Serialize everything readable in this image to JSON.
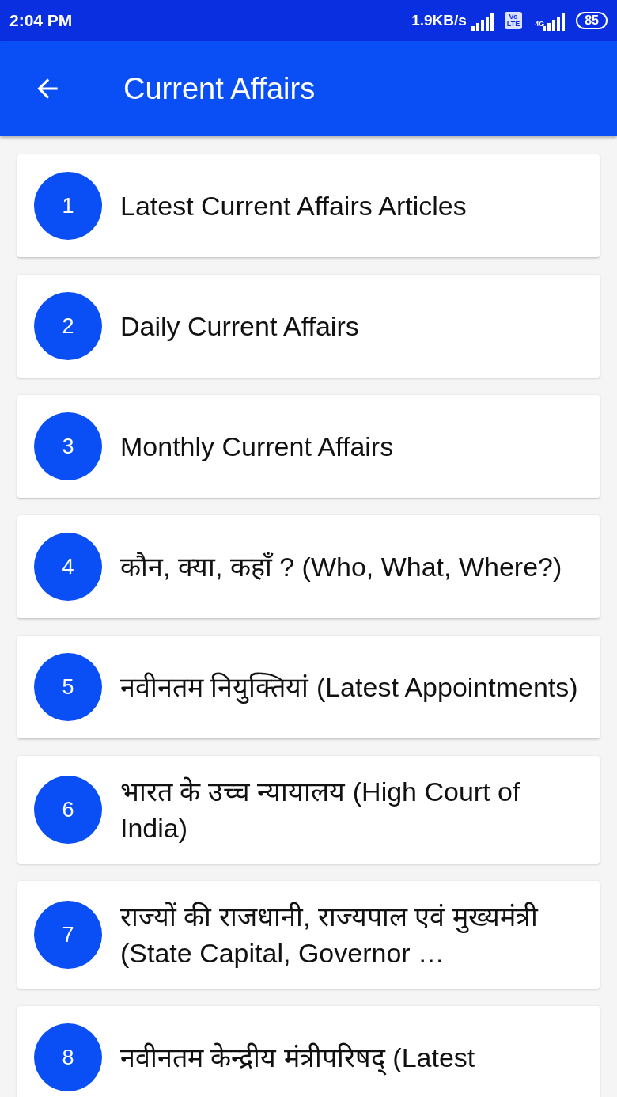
{
  "status_bar": {
    "time": "2:04 PM",
    "network_speed": "1.9KB/s",
    "volte_badge": [
      "Vo",
      "LTE"
    ],
    "network_type": "4G",
    "battery": "85"
  },
  "app_bar": {
    "title": "Current Affairs"
  },
  "items": [
    {
      "number": "1",
      "label": "Latest Current Affairs Articles"
    },
    {
      "number": "2",
      "label": "Daily Current Affairs"
    },
    {
      "number": "3",
      "label": "Monthly Current Affairs"
    },
    {
      "number": "4",
      "label": "कौन, क्या, कहाँ ? (Who, What, Where?)"
    },
    {
      "number": "5",
      "label": "नवीनतम नियुक्तियां (Latest Appointments)"
    },
    {
      "number": "6",
      "label": "भारत के उच्च न्यायालय (High Court of India)"
    },
    {
      "number": "7",
      "label": "राज्यों की राजधानी, राज्यपाल एवं मुख्यमंत्री (State Capital, Governor …"
    },
    {
      "number": "8",
      "label": "नवीनतम केन्द्रीय मंत्रीपरिषद् (Latest"
    }
  ]
}
